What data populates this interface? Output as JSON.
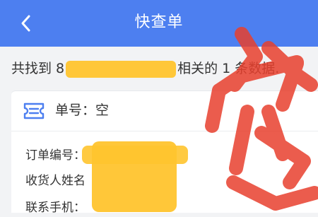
{
  "header": {
    "title": "快查单",
    "back_icon": "chevron-left-icon",
    "background_color": "#4d7ff0"
  },
  "summary": {
    "prefix": "共找到 8",
    "middle": "相关的 1 条数据."
  },
  "order": {
    "icon": "ticket-icon",
    "number_label": "单号：",
    "number_value": "空"
  },
  "fields": [
    {
      "label": "订单编号："
    },
    {
      "label": "收货人姓名"
    },
    {
      "label": "联系手机："
    }
  ],
  "overlays": {
    "redaction_color": "#ffc42e",
    "scribble_color": "#e8402e"
  }
}
